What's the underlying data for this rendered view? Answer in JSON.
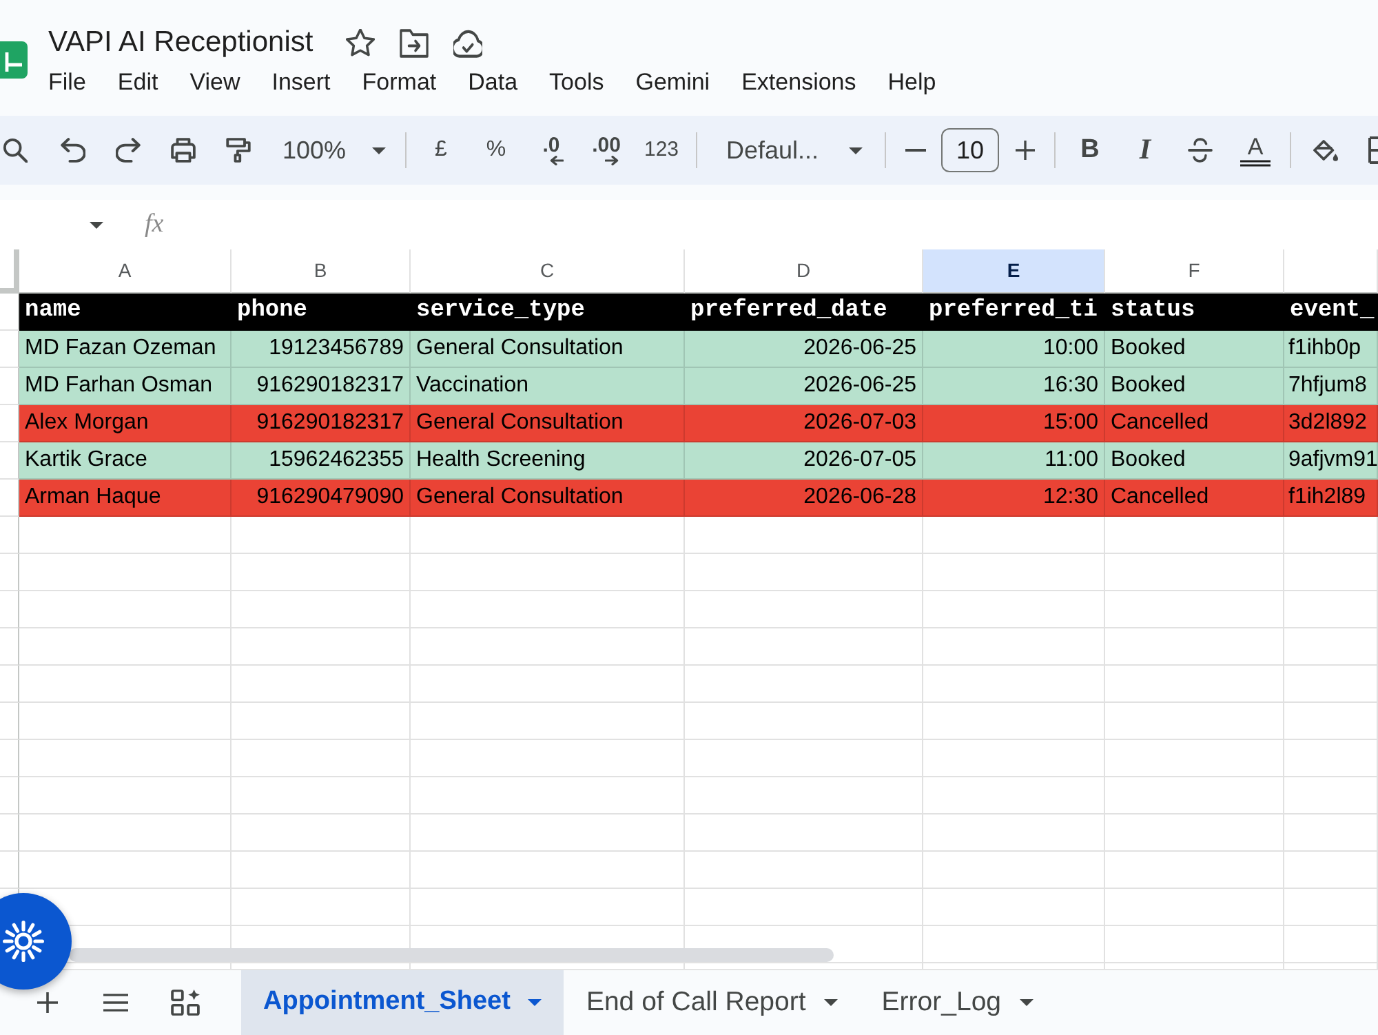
{
  "window": {
    "title": "VAPI AI Receptionist"
  },
  "menu": [
    "File",
    "Edit",
    "View",
    "Insert",
    "Format",
    "Data",
    "Tools",
    "Gemini",
    "Extensions",
    "Help"
  ],
  "toolbar": {
    "zoom": "100%",
    "currency": "£",
    "percent": "%",
    "decrease_decimal": ".0",
    "increase_decimal": ".00",
    "number_format": "123",
    "font": "Defaul...",
    "font_size": "10",
    "bold": "B",
    "italic": "I",
    "text_color": "A"
  },
  "formula_bar": {
    "label": "fx"
  },
  "sheet": {
    "column_letters": [
      {
        "label": "A",
        "selected": false
      },
      {
        "label": "B",
        "selected": false
      },
      {
        "label": "C",
        "selected": false
      },
      {
        "label": "D",
        "selected": false
      },
      {
        "label": "E",
        "selected": true
      },
      {
        "label": "F",
        "selected": false
      }
    ],
    "columns": [
      {
        "header": "name",
        "kind": "text"
      },
      {
        "header": "phone",
        "kind": "number"
      },
      {
        "header": "service_type",
        "kind": "text"
      },
      {
        "header": "preferred_date",
        "kind": "number"
      },
      {
        "header": "preferred_ti",
        "kind": "number"
      },
      {
        "header": "status",
        "kind": "text"
      },
      {
        "header": "event_",
        "kind": "text"
      }
    ],
    "rows": [
      {
        "color": "#b7e1cd",
        "cells": [
          "MD Fazan Ozeman",
          "19123456789",
          "General Consultation",
          "2026-06-25",
          "10:00",
          "Booked",
          "f1ihb0p"
        ]
      },
      {
        "color": "#b7e1cd",
        "cells": [
          "MD Farhan Osman",
          "916290182317",
          "Vaccination",
          "2026-06-25",
          "16:30",
          "Booked",
          "7hfjum8"
        ]
      },
      {
        "color": "#ea4335",
        "cells": [
          "Alex Morgan",
          "916290182317",
          "General Consultation",
          "2026-07-03",
          "15:00",
          "Cancelled",
          "3d2l892"
        ]
      },
      {
        "color": "#b7e1cd",
        "cells": [
          "Kartik Grace",
          "15962462355",
          "Health Screening",
          "2026-07-05",
          "11:00",
          "Booked",
          "9afjvm91"
        ]
      },
      {
        "color": "#ea4335",
        "cells": [
          "Arman Haque",
          "916290479090",
          "General Consultation",
          "2026-06-28",
          "12:30",
          "Cancelled",
          "f1ih2l89"
        ]
      }
    ]
  },
  "sheet_tabs": [
    {
      "label": "Appointment_Sheet",
      "selected": true
    },
    {
      "label": "End of Call Report",
      "selected": false
    },
    {
      "label": "Error_Log",
      "selected": false
    }
  ]
}
